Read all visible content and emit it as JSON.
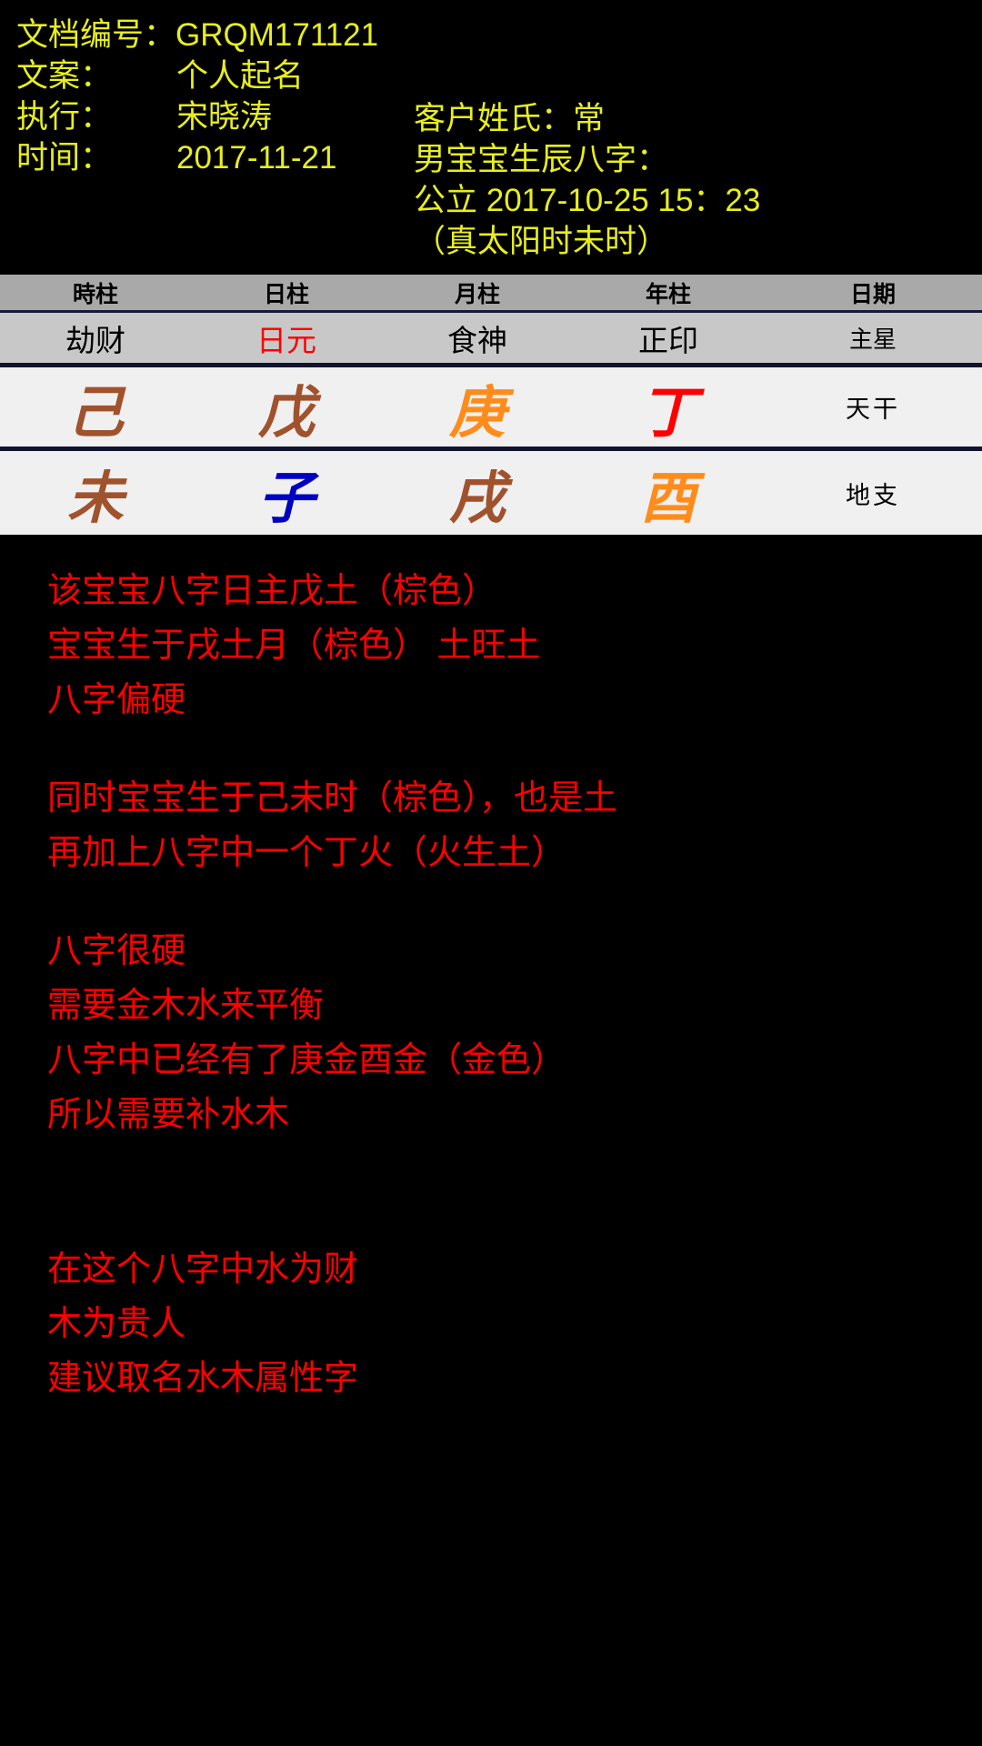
{
  "colors": {
    "background": "#000000",
    "header_text": "#e8ee1c",
    "analysis_text": "#ff0000",
    "table_header_bg": "#a9a9a9",
    "table_stars_bg": "#c8c8c8",
    "table_cell_bg": "#f0f0f0",
    "brown": "#a0522d",
    "orange": "#ff8c1a",
    "red": "#ff0000",
    "blue": "#0000c0"
  },
  "header": {
    "left_rows": [
      {
        "label": "文档编号：",
        "value": "GRQM171121"
      },
      {
        "label": "文案：",
        "value": "个人起名"
      },
      {
        "label": "执行：",
        "value": "宋晓涛"
      },
      {
        "label": "时间：",
        "value": "2017-11-21"
      }
    ],
    "right_lines": [
      "客户姓氏：常",
      "男宝宝生辰八字：",
      "公立 2017-10-25  15：23",
      "（真太阳时未时）"
    ]
  },
  "table": {
    "header": [
      "時柱",
      "日柱",
      "月柱",
      "年柱",
      "日期"
    ],
    "stars": {
      "values": [
        "劫财",
        "日元",
        "食神",
        "正印"
      ],
      "label": "主星"
    },
    "heavenly_stems": {
      "values": [
        "己",
        "戊",
        "庚",
        "丁"
      ],
      "colors": [
        "#a0522d",
        "#a0522d",
        "#ff8c1a",
        "#ff0000"
      ],
      "label": "天干"
    },
    "earthly_branches": {
      "values": [
        "未",
        "子",
        "戌",
        "酉"
      ],
      "colors": [
        "#a0522d",
        "#0000c0",
        "#a0522d",
        "#ff8c1a"
      ],
      "label": "地支"
    }
  },
  "analysis": {
    "p1": [
      "该宝宝八字日主戊土（棕色）",
      "宝宝生于戌土月（棕色） 土旺土",
      "八字偏硬"
    ],
    "p2": [
      "同时宝宝生于己未时（棕色），也是土",
      "再加上八字中一个丁火（火生土）"
    ],
    "p3": [
      "八字很硬",
      "需要金木水来平衡",
      "八字中已经有了庚金酉金（金色）",
      "所以需要补水木"
    ],
    "p4": [
      "在这个八字中水为财",
      "木为贵人",
      "建议取名水木属性字"
    ]
  }
}
